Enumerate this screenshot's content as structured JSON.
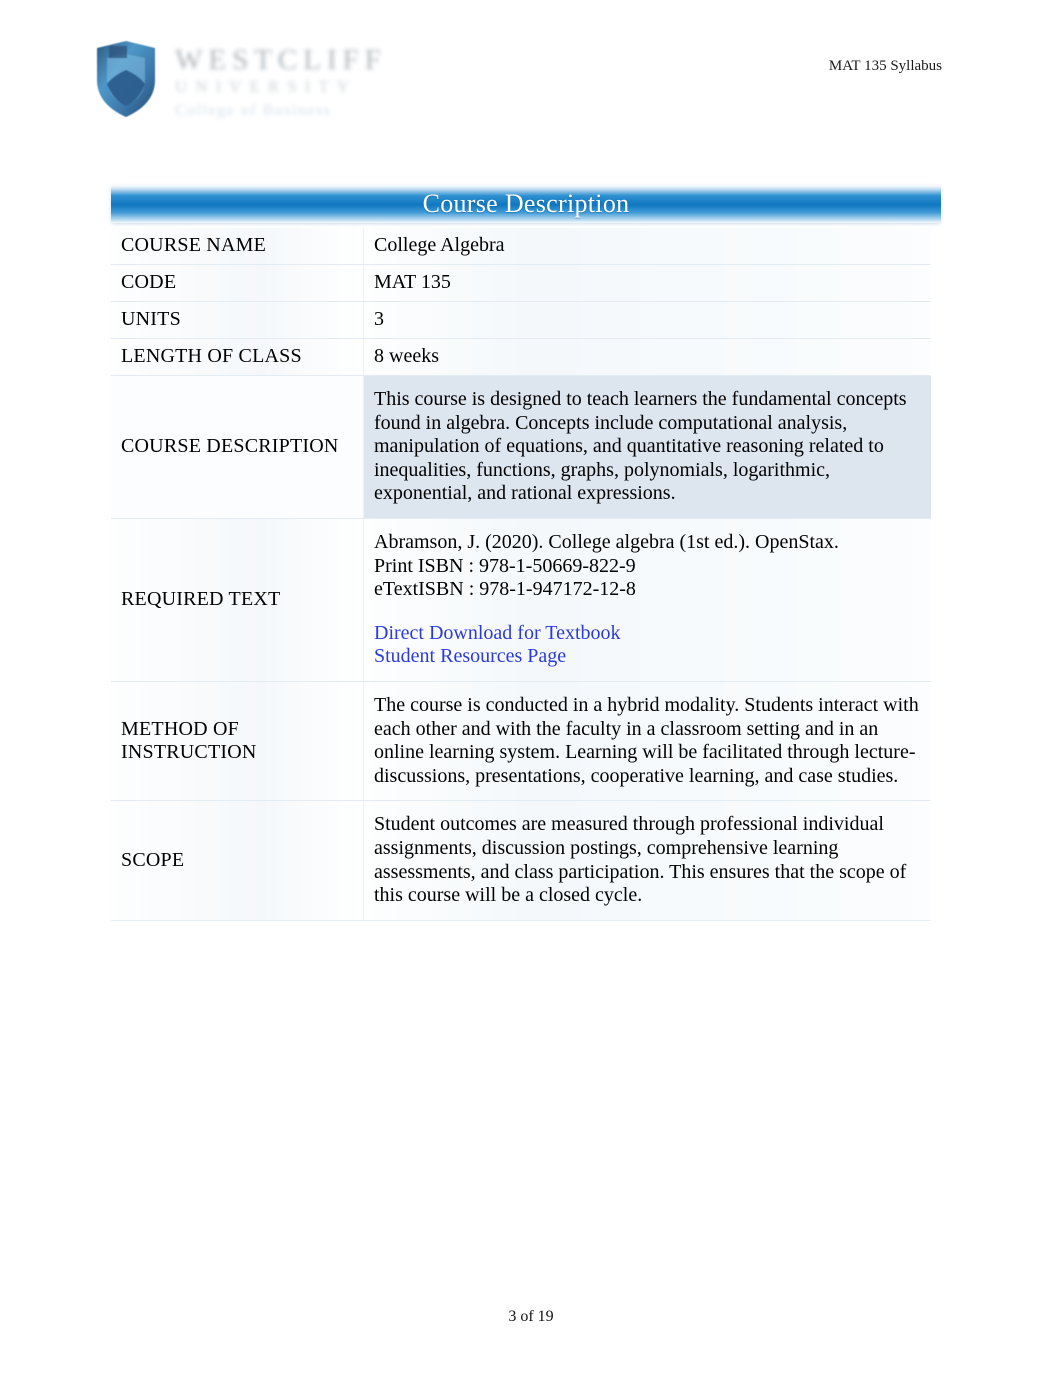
{
  "header": {
    "right_text": "MAT 135 Syllabus",
    "logo": {
      "name": "WESTCLIFF",
      "subtitle": "UNIVERSITY",
      "college": "College of Business",
      "shield_icon": "shield-icon"
    }
  },
  "section": {
    "title": "Course Description"
  },
  "table": {
    "rows": [
      {
        "label": "COURSE NAME",
        "value": "College Algebra"
      },
      {
        "label": "CODE",
        "value": "MAT 135"
      },
      {
        "label": "UNITS",
        "value": "3"
      },
      {
        "label": "LENGTH OF CLASS",
        "value": "8 weeks"
      },
      {
        "label": "COURSE DESCRIPTION",
        "value": "This course is designed to teach learners the fundamental concepts found in algebra.  Concepts include computational analysis, manipulation of equations, and quantitative reasoning related to inequalities, functions, graphs, polynomials, logarithmic, exponential, and rational expressions."
      },
      {
        "label": "REQUIRED TEXT",
        "citation": "Abramson, J. (2020). College algebra  (1st ed.). OpenStax.",
        "print_isbn": "Print ISBN  : 978-1-50669-822-9",
        "etext_isbn": "eTextISBN : 978-1-947172-12-8",
        "link_download": "Direct Download for Textbook",
        "link_resources": "Student Resources Page"
      },
      {
        "label": "METHOD OF INSTRUCTION",
        "value": "The course is conducted in a hybrid modality. Students interact with each other and with the faculty in a classroom setting and in an online learning system. Learning will be facilitated through lecture-discussions, presentations, cooperative learning, and case studies."
      },
      {
        "label": "SCOPE",
        "value": "Student outcomes are measured through professional individual assignments, discussion postings, comprehensive learning assessments, and class participation. This ensures that the scope of this course will be a closed cycle."
      }
    ]
  },
  "footer": {
    "page_indicator": "3 of 19"
  },
  "colors": {
    "banner_blue": "#1077c0",
    "link_blue": "#2b3bd8",
    "shaded_cell": "#dde5ef"
  }
}
